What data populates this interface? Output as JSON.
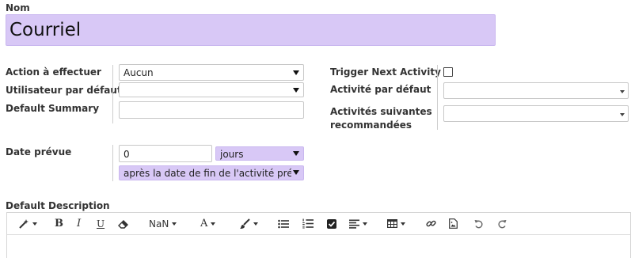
{
  "name_field": {
    "label": "Nom",
    "value": "Courriel"
  },
  "left_column": {
    "action_label": "Action à effectuer",
    "action_value": "Aucun",
    "user_label": "Utilisateur par défaut",
    "user_value": "",
    "summary_label": "Default Summary",
    "summary_value": ""
  },
  "right_column": {
    "trigger_label": "Trigger Next Activity",
    "default_activity_label": "Activité par défaut",
    "default_activity_value": "",
    "recommended_label": "Activités suivantes recommandées",
    "recommended_value": ""
  },
  "date": {
    "label": "Date prévue",
    "number_value": "0",
    "unit_value": "jours",
    "reference_value": "après la date de fin de l'activité précédente"
  },
  "description": {
    "label": "Default Description"
  },
  "toolbar": {
    "font_size_label": "NaN",
    "bold_label": "B",
    "italic_label": "I",
    "underline_label": "U",
    "font_color_label": "A"
  },
  "icons": [
    "magic-wand-icon",
    "eraser-icon",
    "font-color-icon",
    "paint-brush-icon",
    "unordered-list-icon",
    "ordered-list-icon",
    "checklist-icon",
    "align-icon",
    "table-icon",
    "link-icon",
    "file-icon",
    "undo-icon",
    "redo-icon",
    "checkbox-icon"
  ],
  "colors": {
    "highlight": "#d8c8f6",
    "border": "#c8c8c8"
  }
}
